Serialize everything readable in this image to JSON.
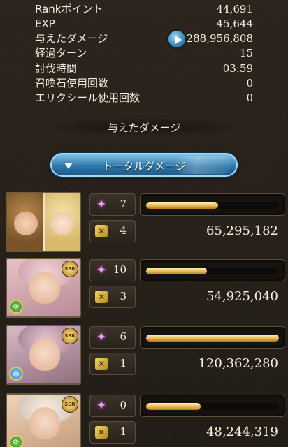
{
  "stats": [
    {
      "label": "Rankポイント",
      "value": "44,691"
    },
    {
      "label": "EXP",
      "value": "45,644"
    },
    {
      "label": "与えたダメージ",
      "value": "288,956,808"
    },
    {
      "label": "経過ターン",
      "value": "15"
    },
    {
      "label": "討伐時間",
      "value": "03:59"
    },
    {
      "label": "召喚石使用回数",
      "value": "0"
    },
    {
      "label": "エリクシール使用回数",
      "value": "0"
    }
  ],
  "section_title": "与えたダメージ",
  "dropdown_label": "トータルダメージ",
  "characters": [
    {
      "skills": "7",
      "attacks": "4",
      "damage": "65,295,182",
      "bar_fraction": 0.54,
      "element": "",
      "rarity": ""
    },
    {
      "skills": "10",
      "attacks": "3",
      "damage": "54,925,040",
      "bar_fraction": 0.46,
      "element": "wind",
      "rarity": "SSR"
    },
    {
      "skills": "6",
      "attacks": "1",
      "damage": "120,362,280",
      "bar_fraction": 1.0,
      "element": "water",
      "rarity": "SSR"
    },
    {
      "skills": "0",
      "attacks": "1",
      "damage": "48,244,319",
      "bar_fraction": 0.41,
      "element": "wind",
      "rarity": "SSR"
    }
  ],
  "colors": {
    "bar_fill": "#e8b24a",
    "dropdown": "#2e78ac",
    "accent_purple": "#e9a2f4"
  },
  "icons": {
    "play": "play-icon",
    "skill": "sparkle-icon",
    "attack": "crossed-swords-icon",
    "caret": "caret-down-icon"
  }
}
